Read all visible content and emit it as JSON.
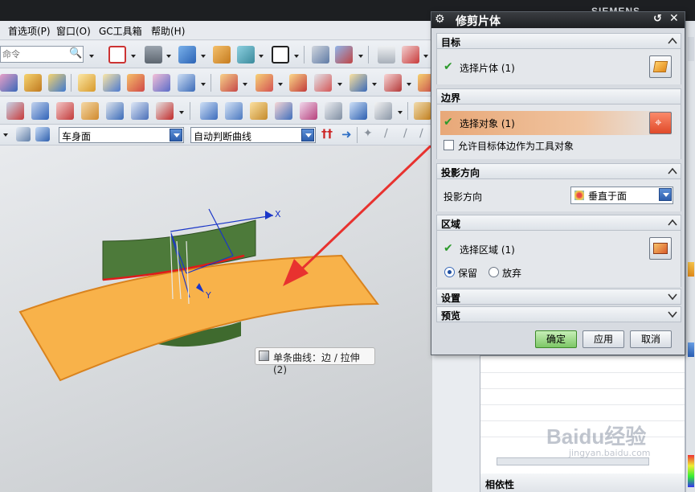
{
  "brand": "SIEMENS",
  "menu": {
    "items": [
      "首选项(P)",
      "窗口(O)",
      "GC工具箱",
      "帮助(H)"
    ]
  },
  "command_finder": {
    "placeholder": "命令"
  },
  "selection_bar": {
    "type_filter": "车身面",
    "curve_rule": "自动判断曲线"
  },
  "viewport": {
    "axis_x": "X",
    "axis_y": "Y",
    "tooltip": "单条曲线：边 / 拉伸(2)"
  },
  "dialog": {
    "title": "修剪片体",
    "sections": {
      "target": {
        "header": "目标",
        "select_label": "选择片体 (1)"
      },
      "boundary": {
        "header": "边界",
        "select_label": "选择对象 (1)",
        "allow_edges_label": "允许目标体边作为工具对象"
      },
      "projection": {
        "header": "投影方向",
        "label": "投影方向",
        "value": "垂直于面"
      },
      "region": {
        "header": "区域",
        "select_label": "选择区域 (1)",
        "keep_label": "保留",
        "discard_label": "放弃",
        "selected": "保留"
      },
      "settings": {
        "header": "设置"
      },
      "preview": {
        "header": "预览"
      }
    },
    "buttons": {
      "ok": "确定",
      "apply": "应用",
      "cancel": "取消"
    }
  },
  "lower_panel": {
    "footer_label": "相依性"
  },
  "colors": {
    "surface_orange": "#f8b24a",
    "extrude_green": "#4d7a3a",
    "boundary_highlight": "#e8a878",
    "arrow_red": "#e8322f",
    "ok_green": "#8fd07a"
  },
  "watermark": "Baidu 经验 jingyan.baidu.com"
}
